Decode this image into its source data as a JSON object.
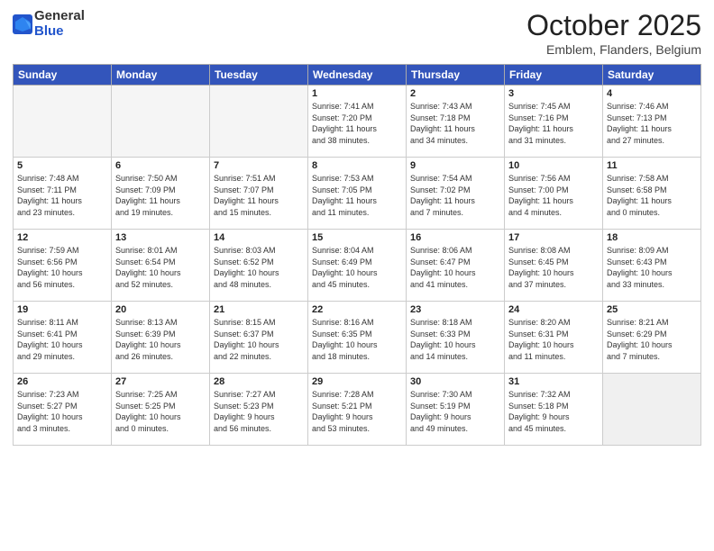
{
  "logo": {
    "general": "General",
    "blue": "Blue"
  },
  "header": {
    "month": "October 2025",
    "location": "Emblem, Flanders, Belgium"
  },
  "weekdays": [
    "Sunday",
    "Monday",
    "Tuesday",
    "Wednesday",
    "Thursday",
    "Friday",
    "Saturday"
  ],
  "weeks": [
    [
      {
        "day": "",
        "info": "",
        "empty": true
      },
      {
        "day": "",
        "info": "",
        "empty": true
      },
      {
        "day": "",
        "info": "",
        "empty": true
      },
      {
        "day": "1",
        "info": "Sunrise: 7:41 AM\nSunset: 7:20 PM\nDaylight: 11 hours\nand 38 minutes."
      },
      {
        "day": "2",
        "info": "Sunrise: 7:43 AM\nSunset: 7:18 PM\nDaylight: 11 hours\nand 34 minutes."
      },
      {
        "day": "3",
        "info": "Sunrise: 7:45 AM\nSunset: 7:16 PM\nDaylight: 11 hours\nand 31 minutes."
      },
      {
        "day": "4",
        "info": "Sunrise: 7:46 AM\nSunset: 7:13 PM\nDaylight: 11 hours\nand 27 minutes."
      }
    ],
    [
      {
        "day": "5",
        "info": "Sunrise: 7:48 AM\nSunset: 7:11 PM\nDaylight: 11 hours\nand 23 minutes."
      },
      {
        "day": "6",
        "info": "Sunrise: 7:50 AM\nSunset: 7:09 PM\nDaylight: 11 hours\nand 19 minutes."
      },
      {
        "day": "7",
        "info": "Sunrise: 7:51 AM\nSunset: 7:07 PM\nDaylight: 11 hours\nand 15 minutes."
      },
      {
        "day": "8",
        "info": "Sunrise: 7:53 AM\nSunset: 7:05 PM\nDaylight: 11 hours\nand 11 minutes."
      },
      {
        "day": "9",
        "info": "Sunrise: 7:54 AM\nSunset: 7:02 PM\nDaylight: 11 hours\nand 7 minutes."
      },
      {
        "day": "10",
        "info": "Sunrise: 7:56 AM\nSunset: 7:00 PM\nDaylight: 11 hours\nand 4 minutes."
      },
      {
        "day": "11",
        "info": "Sunrise: 7:58 AM\nSunset: 6:58 PM\nDaylight: 11 hours\nand 0 minutes."
      }
    ],
    [
      {
        "day": "12",
        "info": "Sunrise: 7:59 AM\nSunset: 6:56 PM\nDaylight: 10 hours\nand 56 minutes."
      },
      {
        "day": "13",
        "info": "Sunrise: 8:01 AM\nSunset: 6:54 PM\nDaylight: 10 hours\nand 52 minutes."
      },
      {
        "day": "14",
        "info": "Sunrise: 8:03 AM\nSunset: 6:52 PM\nDaylight: 10 hours\nand 48 minutes."
      },
      {
        "day": "15",
        "info": "Sunrise: 8:04 AM\nSunset: 6:49 PM\nDaylight: 10 hours\nand 45 minutes."
      },
      {
        "day": "16",
        "info": "Sunrise: 8:06 AM\nSunset: 6:47 PM\nDaylight: 10 hours\nand 41 minutes."
      },
      {
        "day": "17",
        "info": "Sunrise: 8:08 AM\nSunset: 6:45 PM\nDaylight: 10 hours\nand 37 minutes."
      },
      {
        "day": "18",
        "info": "Sunrise: 8:09 AM\nSunset: 6:43 PM\nDaylight: 10 hours\nand 33 minutes."
      }
    ],
    [
      {
        "day": "19",
        "info": "Sunrise: 8:11 AM\nSunset: 6:41 PM\nDaylight: 10 hours\nand 29 minutes."
      },
      {
        "day": "20",
        "info": "Sunrise: 8:13 AM\nSunset: 6:39 PM\nDaylight: 10 hours\nand 26 minutes."
      },
      {
        "day": "21",
        "info": "Sunrise: 8:15 AM\nSunset: 6:37 PM\nDaylight: 10 hours\nand 22 minutes."
      },
      {
        "day": "22",
        "info": "Sunrise: 8:16 AM\nSunset: 6:35 PM\nDaylight: 10 hours\nand 18 minutes."
      },
      {
        "day": "23",
        "info": "Sunrise: 8:18 AM\nSunset: 6:33 PM\nDaylight: 10 hours\nand 14 minutes."
      },
      {
        "day": "24",
        "info": "Sunrise: 8:20 AM\nSunset: 6:31 PM\nDaylight: 10 hours\nand 11 minutes."
      },
      {
        "day": "25",
        "info": "Sunrise: 8:21 AM\nSunset: 6:29 PM\nDaylight: 10 hours\nand 7 minutes."
      }
    ],
    [
      {
        "day": "26",
        "info": "Sunrise: 7:23 AM\nSunset: 5:27 PM\nDaylight: 10 hours\nand 3 minutes."
      },
      {
        "day": "27",
        "info": "Sunrise: 7:25 AM\nSunset: 5:25 PM\nDaylight: 10 hours\nand 0 minutes."
      },
      {
        "day": "28",
        "info": "Sunrise: 7:27 AM\nSunset: 5:23 PM\nDaylight: 9 hours\nand 56 minutes."
      },
      {
        "day": "29",
        "info": "Sunrise: 7:28 AM\nSunset: 5:21 PM\nDaylight: 9 hours\nand 53 minutes."
      },
      {
        "day": "30",
        "info": "Sunrise: 7:30 AM\nSunset: 5:19 PM\nDaylight: 9 hours\nand 49 minutes."
      },
      {
        "day": "31",
        "info": "Sunrise: 7:32 AM\nSunset: 5:18 PM\nDaylight: 9 hours\nand 45 minutes."
      },
      {
        "day": "",
        "info": "",
        "empty": true
      }
    ]
  ]
}
